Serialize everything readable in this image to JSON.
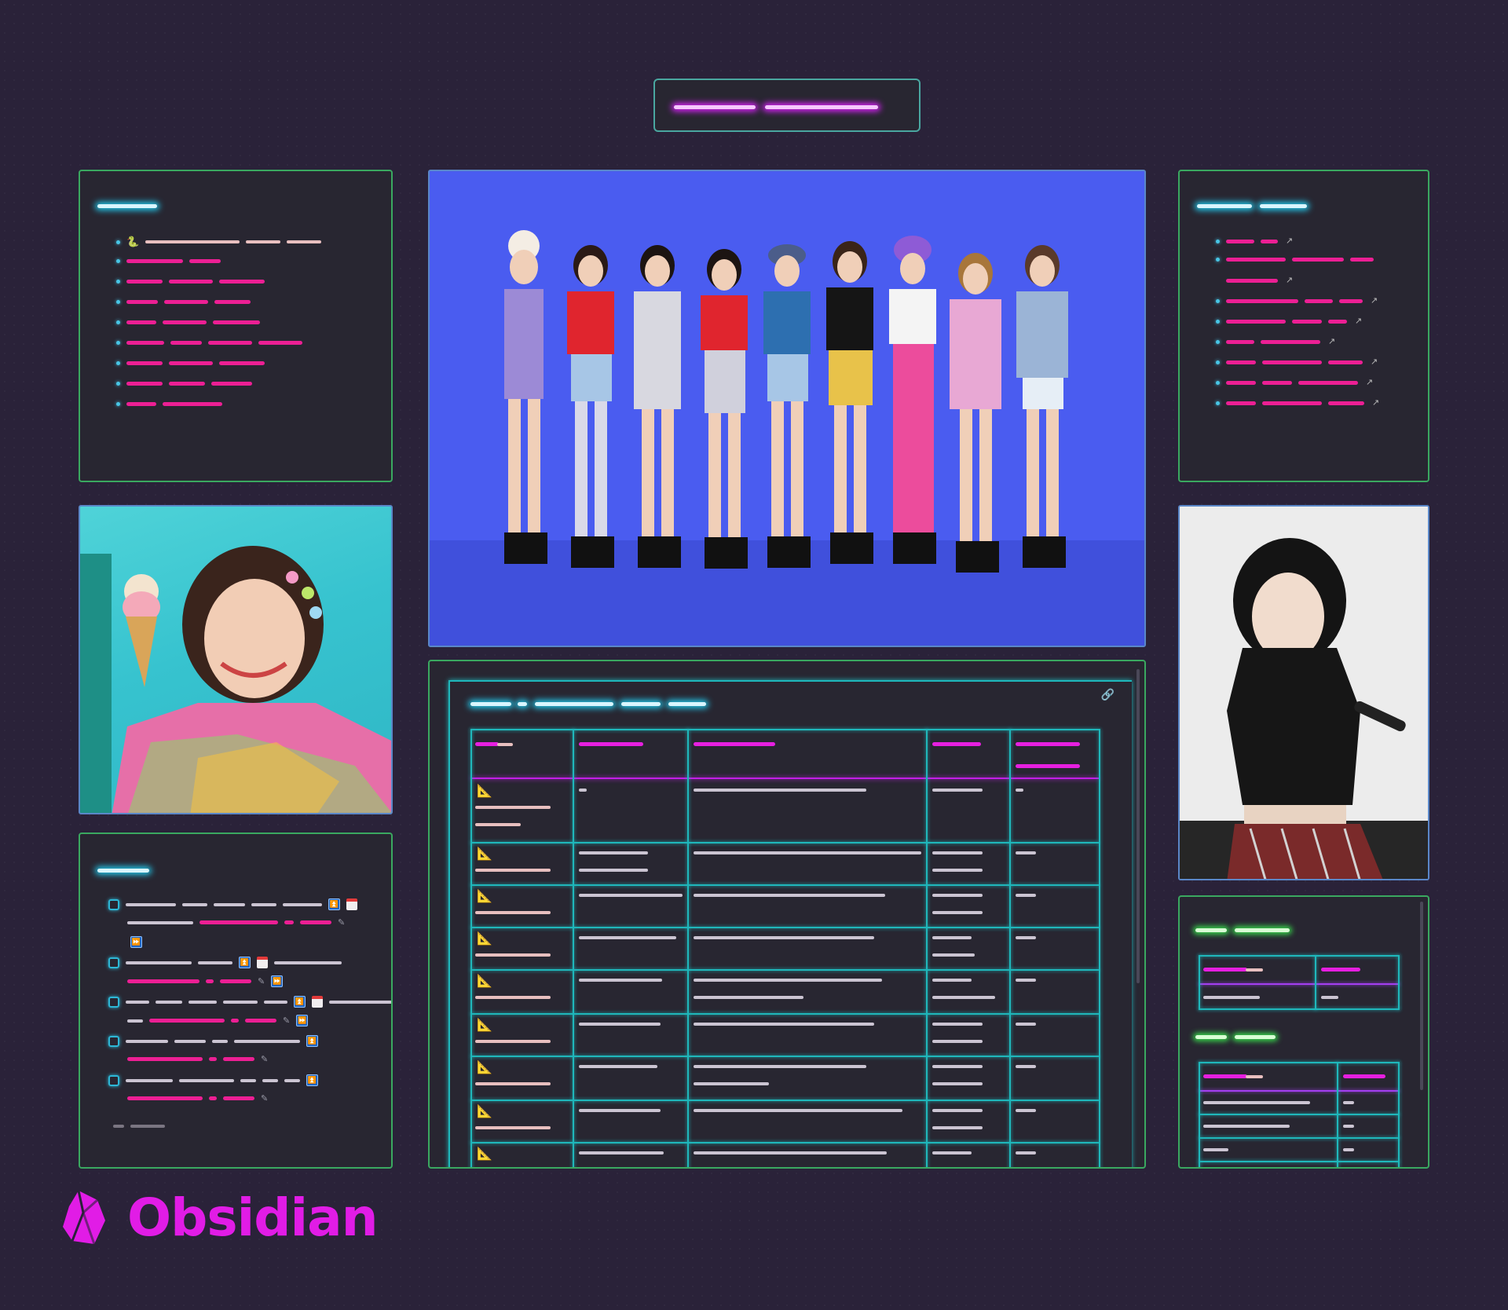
{
  "app": {
    "name": "Obsidian"
  },
  "colors": {
    "accent": "#e11ce6",
    "panel_border": "#3aa860",
    "table_grid": "#1fb7bb",
    "background": "#2a2239"
  },
  "photos": {
    "group": {
      "icon": "group-photo-icon"
    },
    "ice_cream_portrait": {
      "icon": "portrait-photo-icon"
    },
    "stage_portrait": {
      "icon": "performer-photo-icon"
    }
  },
  "table_panel": {
    "link_icon": "🔗",
    "row_icon": "📐"
  },
  "tasks": {
    "calendar_icon": "calendar-icon",
    "priority_icon": "⏫",
    "forward_icon": "⏩",
    "pencil_icon": "✎"
  }
}
